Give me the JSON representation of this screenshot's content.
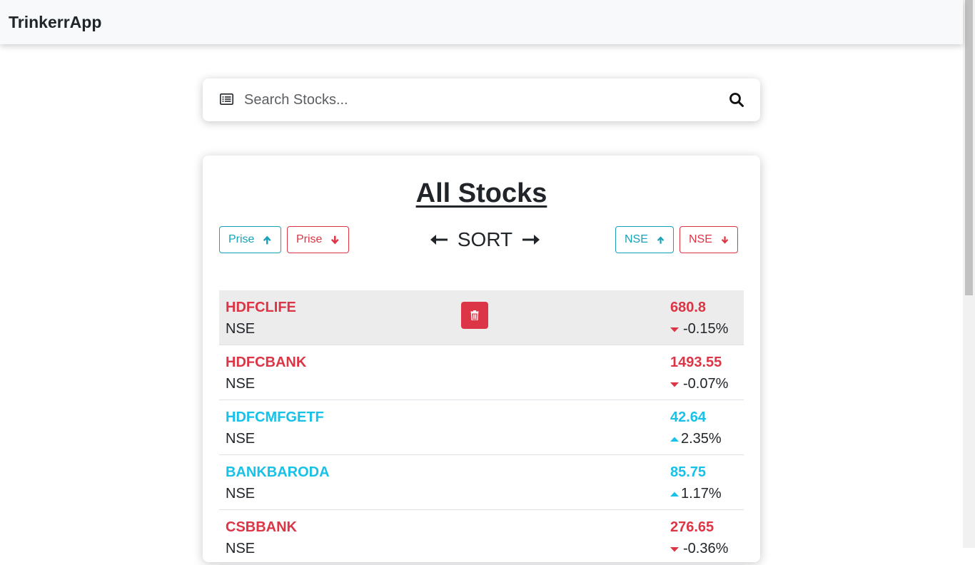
{
  "navbar": {
    "brand": "TrinkerrApp"
  },
  "search": {
    "placeholder": "Search Stocks..."
  },
  "stocks_card": {
    "title": "All Stocks",
    "sort_label": "SORT",
    "buttons": {
      "price_asc": "Prise",
      "price_desc": "Prise",
      "nse_asc": "NSE",
      "nse_desc": "NSE"
    }
  },
  "stocks": [
    {
      "name": "HDFCLIFE",
      "exchange": "NSE",
      "price": "680.8",
      "change": "-0.15%",
      "direction": "down"
    },
    {
      "name": "HDFCBANK",
      "exchange": "NSE",
      "price": "1493.55",
      "change": "-0.07%",
      "direction": "down"
    },
    {
      "name": "HDFCMFGETF",
      "exchange": "NSE",
      "price": "42.64",
      "change": "2.35%",
      "direction": "up"
    },
    {
      "name": "BANKBARODA",
      "exchange": "NSE",
      "price": "85.75",
      "change": "1.17%",
      "direction": "up"
    },
    {
      "name": "CSBBANK",
      "exchange": "NSE",
      "price": "276.65",
      "change": "-0.36%",
      "direction": "down"
    }
  ],
  "colors": {
    "negative": "#dc3545",
    "positive": "#17c1e8",
    "info": "#17a2b8",
    "navbar_bg": "#f8f9fa",
    "active_row_bg": "#ececec"
  },
  "icons": {
    "search_left": "list-alt-icon",
    "search_button": "search-icon",
    "delete": "trash-icon",
    "sort_left": "arrow-left-icon",
    "sort_right": "arrow-right-icon",
    "asc": "arrow-up-icon",
    "desc": "arrow-down-icon",
    "change_up": "caret-up-icon",
    "change_down": "caret-down-icon"
  }
}
